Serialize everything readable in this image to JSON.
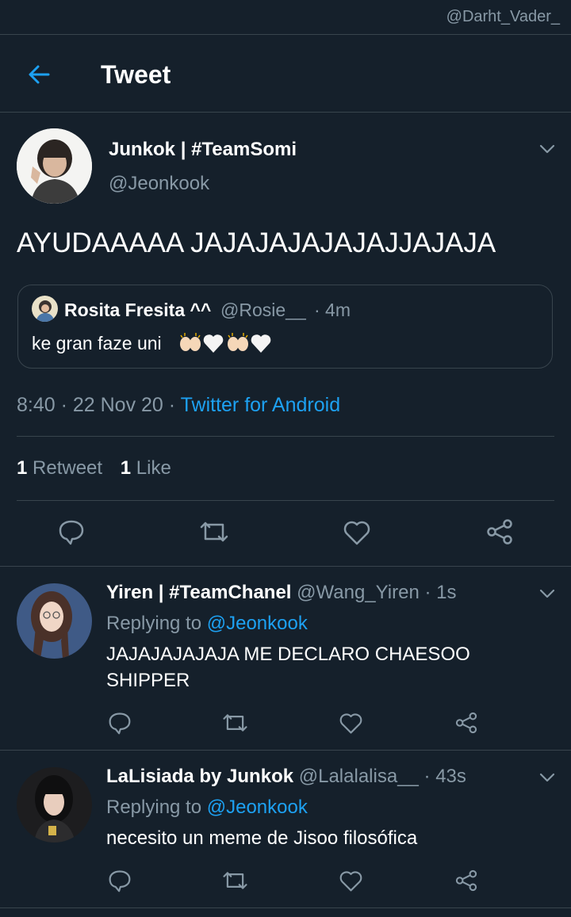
{
  "watermark": "@Darht_Vader_",
  "header": {
    "title": "Tweet"
  },
  "main_tweet": {
    "display_name": "Junkok | #TeamSomi",
    "handle": "@Jeonkook",
    "text": "AYUDAAAAA JAJAJAJAJAJAJJAJAJA",
    "quoted": {
      "display_name": "Rosita Fresita ^^",
      "handle": "@Rosie__",
      "time": "· 4m",
      "text": "ke gran faze uni"
    },
    "timestamp": "8:40 · 22 Nov 20 ·",
    "source": "Twitter for Android",
    "retweet_count": "1",
    "retweet_label": "Retweet",
    "like_count": "1",
    "like_label": "Like"
  },
  "replies": [
    {
      "display_name": "Yiren | #TeamChanel",
      "handle": "@Wang_Yiren",
      "time": "· 1s",
      "replying_prefix": "Replying to",
      "replying_handle": "@Jeonkook",
      "text_line1": "JAJAJAJAJAJA ME DECLARO CHAESOO",
      "text_line2": "SHIPPER"
    },
    {
      "display_name": "LaLisiada by Junkok",
      "handle": "@Lalalalisa__",
      "time": "· 43s",
      "replying_prefix": "Replying to",
      "replying_handle": "@Jeonkook",
      "text_line1": "necesito un meme de Jisoo filosófica"
    }
  ],
  "colors": {
    "background": "#15202b",
    "accent": "#1da1f2",
    "muted": "#8899a6",
    "divider": "#38444d"
  }
}
